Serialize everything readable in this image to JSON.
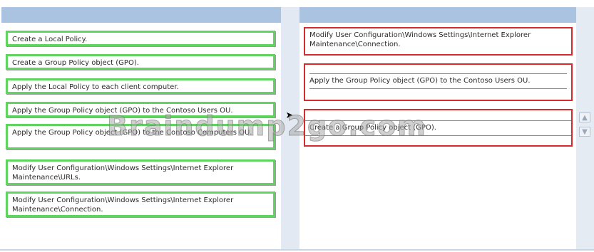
{
  "left_list": {
    "items": [
      "Create a Local Policy.",
      "Create a Group Policy object (GPO).",
      "Apply the Local Policy to each client computer.",
      "Apply the Group Policy object (GPO) to the Contoso Users OU.",
      "Apply the Group Policy object (GPO) to the Contoso Computers OU.",
      "Modify User Configuration\\Windows Settings\\Internet Explorer Maintenance\\URLs.",
      "Modify User Configuration\\Windows Settings\\Internet Explorer Maintenance\\Connection."
    ]
  },
  "right_list": {
    "items": [
      "Modify User Configuration\\Windows Settings\\Internet Explorer Maintenance\\Connection.",
      "Apply the Group Policy object (GPO) to the Contoso Users OU.",
      "Create a Group Policy object (GPO)."
    ]
  },
  "controls": {
    "move_right_icon": "arrow-right",
    "move_up_icon": "arrow-up",
    "move_down_icon": "arrow-down"
  },
  "watermark": {
    "text": "Braindump2go.com"
  },
  "colors": {
    "header": "#a9c3e0",
    "left_item_border": "#5fd45f",
    "right_item_border": "#d62b2b"
  }
}
